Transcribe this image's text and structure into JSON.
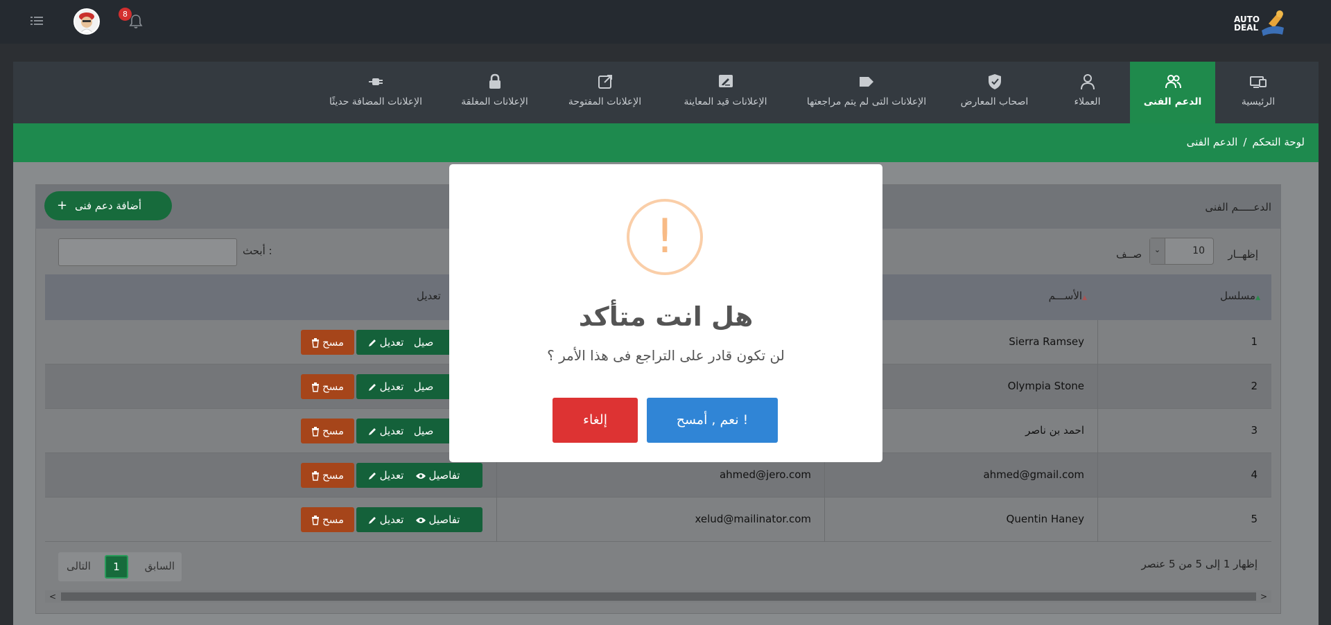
{
  "header": {
    "logo_text": "AUTO\nDEAL",
    "notification_count": "8",
    "icons": {
      "menu": "list-icon",
      "bell": "bell-icon",
      "avatar": "user-avatar"
    }
  },
  "nav": {
    "items": [
      {
        "label": "الرئيسية",
        "icon": "dashboard-icon",
        "active": false
      },
      {
        "label": "الدعم الفنى",
        "icon": "users-icon",
        "active": true
      },
      {
        "label": "العملاء",
        "icon": "user-icon",
        "active": false
      },
      {
        "label": "اصحاب المعارض",
        "icon": "shield-check-icon",
        "active": false
      },
      {
        "label": "الإعلانات التى لم يتم مراجعتها",
        "icon": "tag-icon",
        "active": false
      },
      {
        "label": "الإعلانات قيد المعاينة",
        "icon": "edit-square-icon",
        "active": false
      },
      {
        "label": "الإعلانات المفتوحة",
        "icon": "external-link-icon",
        "active": false
      },
      {
        "label": "الإعلانات المغلقة",
        "icon": "lock-icon",
        "active": false
      },
      {
        "label": "الإعلانات المضافة حديثًا",
        "icon": "plug-icon",
        "active": false
      }
    ]
  },
  "breadcrumb": {
    "home": "لوحة التحكم",
    "separator": "/",
    "current": "الدعم الفنى"
  },
  "card": {
    "title": "الدعـــــم الفنى",
    "add_button": "أضافة دعم فنى",
    "add_icon": "+"
  },
  "table_controls": {
    "show_label": "إظهــار",
    "length_value": "10",
    "rows_label": "صــف",
    "search_label": "أبحث :",
    "search_value": ""
  },
  "table": {
    "columns": [
      "مسلسل",
      "الأســـم",
      "تعديل"
    ],
    "rows": [
      {
        "serial": "1",
        "name": "Sierra Ramsey",
        "email": ""
      },
      {
        "serial": "2",
        "name": "Olympia Stone",
        "email": ""
      },
      {
        "serial": "3",
        "name": "احمد بن ناصر",
        "email": ""
      },
      {
        "serial": "4",
        "name": "ahmed@gmail.com",
        "email": "ahmed@jero.com"
      },
      {
        "serial": "5",
        "name": "Quentin Haney",
        "email": "xelud@mailinator.com"
      }
    ],
    "actions": {
      "details": "تفاصيل",
      "details_partial": "صيل",
      "edit": "تعديل",
      "delete": "مسح"
    }
  },
  "footer": {
    "info": "إظهار 1 إلى 5 من 5 عنصر",
    "prev": "السابق",
    "current_page": "1",
    "next": "التالى"
  },
  "modal": {
    "icon": "!",
    "title": "هل انت متأكد",
    "text": "لن تكون قادر على التراجع فى هذا الأمر ؟",
    "confirm": "نعم , أمسح !",
    "cancel": "إلغاء"
  }
}
